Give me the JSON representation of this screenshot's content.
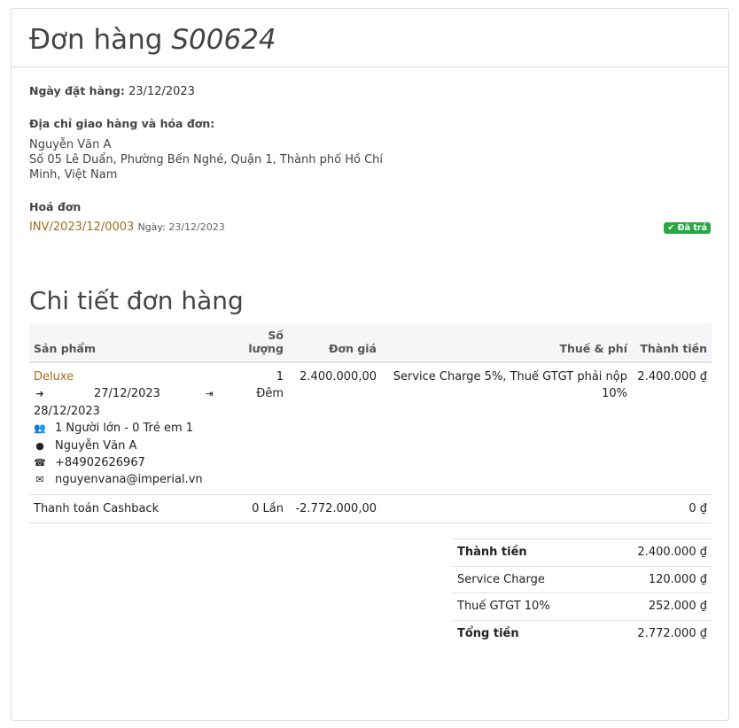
{
  "header": {
    "prefix": "Đơn hàng",
    "ref": "S00624"
  },
  "order_date": {
    "label": "Ngày đặt hàng:",
    "value": "23/12/2023"
  },
  "address": {
    "label": "Địa chỉ giao hàng và hóa đơn:",
    "name": "Nguyễn Văn A",
    "line": "Số 05 Lê Duẩn, Phường Bến Nghé, Quận 1, Thành phố Hồ Chí Minh, Việt Nam"
  },
  "invoice": {
    "label": "Hoá đơn",
    "number": "INV/2023/12/0003",
    "date_label": "Ngày:",
    "date": "23/12/2023",
    "status": "Đã trả",
    "status_color": "#28a745"
  },
  "details": {
    "title": "Chi tiết đơn hàng",
    "columns": {
      "product": "Sản phẩm",
      "qty": "Số lượng",
      "price": "Đơn giá",
      "taxes": "Thuế & phí",
      "subtotal": "Thành tiền"
    },
    "lines": [
      {
        "product": "Deluxe",
        "checkin": "27/12/2023",
        "checkout": "28/12/2023",
        "guests": "1 Người lớn - 0 Trẻ em 1",
        "contact_name": "Nguyễn Văn A",
        "phone": "+84902626967",
        "email": "nguyenvana@imperial.vn",
        "qty": "1 Đêm",
        "price": "2.400.000,00",
        "taxes": "Service Charge 5%, Thuế GTGT phải nộp 10%",
        "subtotal": "2.400.000 ₫"
      },
      {
        "product": "Thanh toán Cashback",
        "qty": "0 Lần",
        "price": "-2.772.000,00",
        "taxes": "",
        "subtotal": "0 ₫"
      }
    ]
  },
  "totals": [
    {
      "label": "Thành tiền",
      "value": "2.400.000 ₫",
      "bold": true
    },
    {
      "label": "Service Charge",
      "value": "120.000 ₫",
      "bold": false
    },
    {
      "label": "Thuế GTGT 10%",
      "value": "252.000 ₫",
      "bold": false
    },
    {
      "label": "Tổng tiền",
      "value": "2.772.000 ₫",
      "bold": true
    }
  ],
  "colors": {
    "link": "#a46d1b",
    "header_bg": "#f5f6f8",
    "border": "#dee2e6"
  },
  "icons": [
    "sign-in-icon",
    "sign-out-icon",
    "users-icon",
    "user-icon",
    "phone-icon",
    "envelope-icon",
    "check-icon"
  ]
}
